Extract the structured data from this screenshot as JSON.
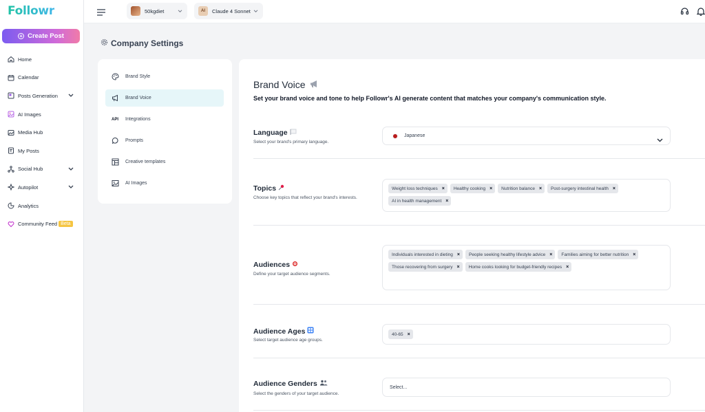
{
  "sidebar": {
    "logo": "Followr",
    "create_post": "Create Post",
    "items": [
      {
        "label": "Home",
        "icon": "home-icon"
      },
      {
        "label": "Calendar",
        "icon": "calendar-icon"
      },
      {
        "label": "Posts Generation",
        "icon": "posts-generation-icon",
        "expandable": true
      },
      {
        "label": "AI Images",
        "icon": "ai-images-icon"
      },
      {
        "label": "Media Hub",
        "icon": "media-hub-icon"
      },
      {
        "label": "My Posts",
        "icon": "my-posts-icon"
      },
      {
        "label": "Social Hub",
        "icon": "social-hub-icon",
        "expandable": true
      },
      {
        "label": "Autopilot",
        "icon": "autopilot-icon",
        "expandable": true
      },
      {
        "label": "Analytics",
        "icon": "analytics-icon"
      },
      {
        "label": "Community Feed",
        "icon": "heart-icon",
        "badge": "Beta"
      }
    ]
  },
  "topbar": {
    "account": "50kgdiet",
    "model": "Claude 4 Sonnet",
    "model_badge": "AI"
  },
  "page_title": "Company Settings",
  "settings_nav": [
    {
      "label": "Brand Style",
      "icon": "palette-icon",
      "active": false
    },
    {
      "label": "Brand Voice",
      "icon": "megaphone-icon",
      "active": true
    },
    {
      "label": "Integrations",
      "icon": "api-icon",
      "active": false
    },
    {
      "label": "Prompts",
      "icon": "chat-bubble-icon",
      "active": false
    },
    {
      "label": "Creative templates",
      "icon": "template-icon",
      "active": false
    },
    {
      "label": "AI Images",
      "icon": "image-icon",
      "active": false
    }
  ],
  "brand_voice": {
    "title": "Brand Voice",
    "description": "Set your brand voice and tone to help Followr's AI generate content that matches your company's communication style.",
    "language": {
      "label": "Language",
      "sub": "Select your brand's primary language.",
      "value": "Japanese"
    },
    "topics": {
      "label": "Topics",
      "sub": "Choose key topics that reflect your brand's interests.",
      "chips": [
        "Weight loss techniques",
        "Healthy cooking",
        "Nutrition balance",
        "Post-surgery intestinal health",
        "AI in health management"
      ]
    },
    "audiences": {
      "label": "Audiences",
      "sub": "Define your target audience segments.",
      "chips": [
        "Individuals interested in dieting",
        "People seeking healthy lifestyle advice",
        "Families aiming for better nutrition",
        "Those recovering from surgery",
        "Home cooks looking for budget-friendly recipes"
      ]
    },
    "ages": {
      "label": "Audience Ages",
      "sub": "Select target audience age groups.",
      "chips": [
        "40-65"
      ]
    },
    "genders": {
      "label": "Audience Genders",
      "sub": "Select the genders of your target audience.",
      "placeholder": "Select..."
    }
  }
}
